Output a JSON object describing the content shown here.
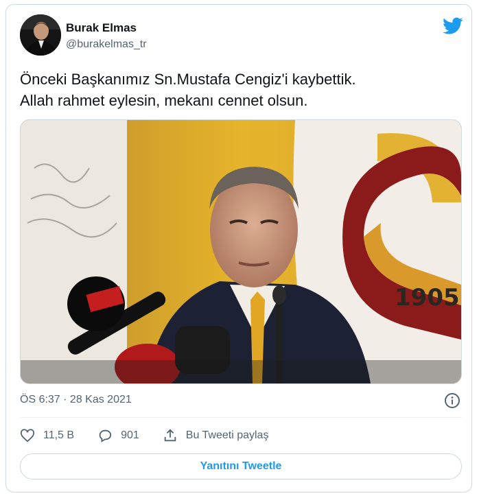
{
  "author": {
    "name": "Burak Elmas",
    "handle": "@burakelmas_tr"
  },
  "tweet": {
    "line1": "Önceki Başkanımız Sn.Mustafa Cengiz'i kaybettik.",
    "line2": "Allah rahmet eylesin, mekanı cennet olsun.",
    "timestamp": "ÖS 6:37 · 28 Kas 2021"
  },
  "photo": {
    "emblem_year": "1905"
  },
  "actions": {
    "likes": "11,5 B",
    "replies": "901",
    "share_label": "Bu Tweeti paylaş"
  },
  "reply_button_label": "Yanıtını Tweetle",
  "icons": [
    "twitter-bird-icon",
    "info-icon",
    "heart-icon",
    "reply-bubble-icon",
    "share-icon"
  ],
  "colors": {
    "accent": "#1d9bf0",
    "text": "#0f1419",
    "muted": "#536471",
    "border": "#cfd9de",
    "banner_gold": "#e8b421",
    "banner_maroon": "#8b1a1a"
  }
}
